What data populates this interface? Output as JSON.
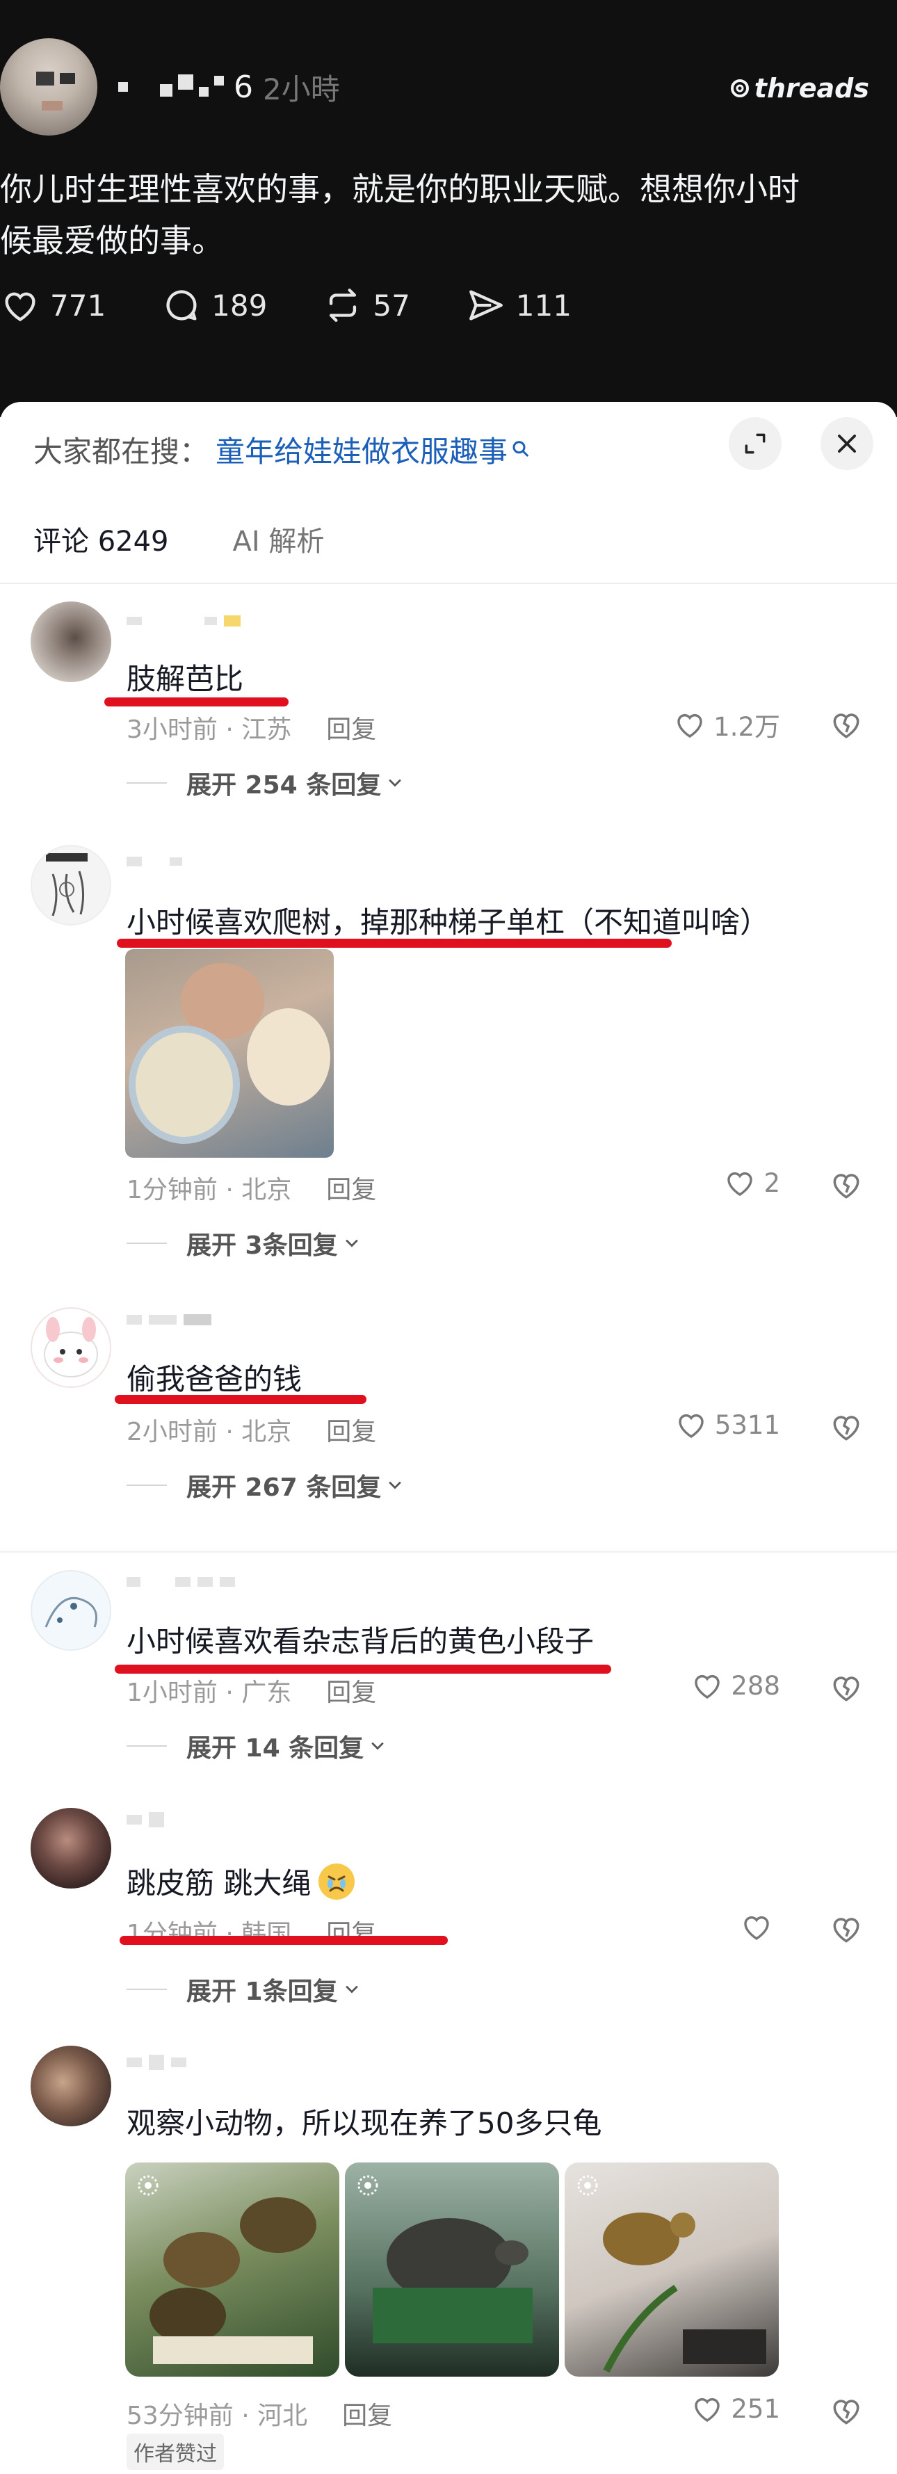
{
  "post": {
    "username_tail": "6",
    "time": "2小時",
    "brand": "threads",
    "text_line1": "你儿时生理性喜欢的事，就是你的职业天赋。想想你小时",
    "text_line2": "候最爱做的事。",
    "likes": "771",
    "replies": "189",
    "reposts": "57",
    "shares": "111"
  },
  "sheet": {
    "search_prefix": "大家都在搜：",
    "search_link": "童年给娃娃做衣服趣事",
    "tabs": [
      {
        "label": "评论 6249",
        "active": true
      },
      {
        "label": "AI 解析",
        "active": false
      }
    ]
  },
  "comments": [
    {
      "text": "肢解芭比",
      "time_location": "3小时前 · 江苏",
      "reply": "回复",
      "likes": "1.2万",
      "expand": "展开 254 条回复"
    },
    {
      "text": "小时候喜欢爬树，掉那种梯子单杠（不知道叫啥）",
      "time_location": "1分钟前 · 北京",
      "reply": "回复",
      "likes": "2",
      "expand": "展开 3条回复"
    },
    {
      "text": "偷我爸爸的钱",
      "time_location": "2小时前 · 北京",
      "reply": "回复",
      "likes": "5311",
      "expand": "展开 267 条回复"
    },
    {
      "text": "小时候喜欢看杂志背后的黄色小段子",
      "time_location": "1小时前 · 广东",
      "reply": "回复",
      "likes": "288",
      "expand": "展开 14 条回复"
    },
    {
      "text": "跳皮筋 跳大绳",
      "time_location": "1分钟前 · 韩国",
      "reply": "回复",
      "likes": "",
      "expand": "展开 1条回复"
    },
    {
      "text": "观察小动物，所以现在养了50多只龟",
      "time_location": "53分钟前 · 河北",
      "reply": "回复",
      "likes": "251",
      "badge": "作者赞过"
    }
  ],
  "colors": {
    "underline": "#e0101e",
    "link": "#1b5fb8",
    "dark_bg": "#101010"
  }
}
